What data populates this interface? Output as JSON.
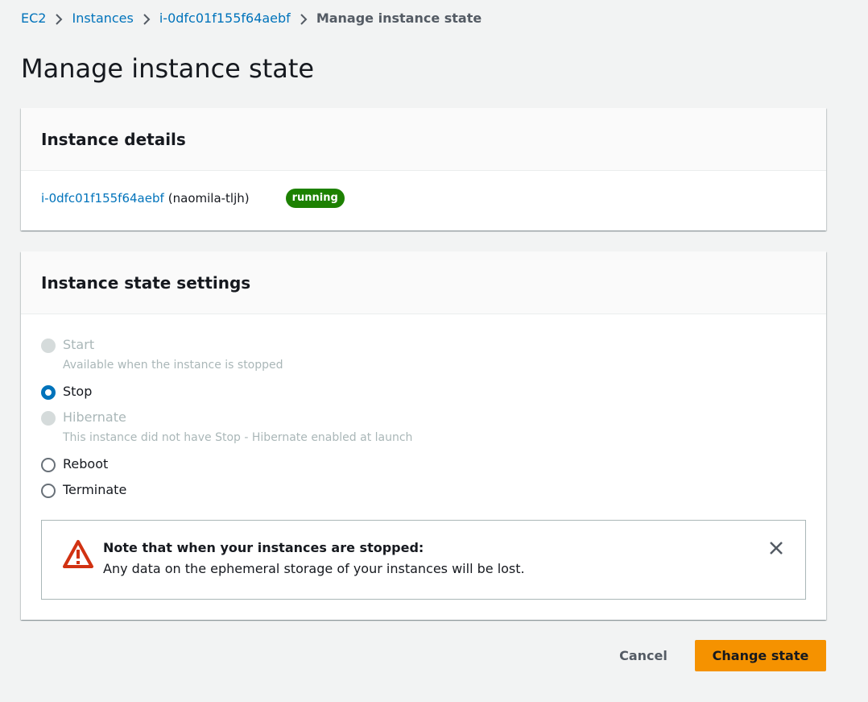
{
  "breadcrumb": {
    "items": [
      "EC2",
      "Instances",
      "i-0dfc01f155f64aebf"
    ],
    "current": "Manage instance state"
  },
  "page_title": "Manage instance state",
  "details": {
    "title": "Instance details",
    "instance_id": "i-0dfc01f155f64aebf",
    "instance_name": "(naomila-tljh)",
    "status": "running",
    "status_color": "#1d8102"
  },
  "settings": {
    "title": "Instance state settings",
    "options": [
      {
        "label": "Start",
        "description": "Available when the instance is stopped",
        "state": "disabled"
      },
      {
        "label": "Stop",
        "description": "",
        "state": "checked"
      },
      {
        "label": "Hibernate",
        "description": "This instance did not have Stop - Hibernate enabled at launch",
        "state": "disabled"
      },
      {
        "label": "Reboot",
        "description": "",
        "state": "enabled"
      },
      {
        "label": "Terminate",
        "description": "",
        "state": "enabled"
      }
    ],
    "selected": "Stop"
  },
  "alert": {
    "icon": "warning-icon",
    "title": "Note that when your instances are stopped:",
    "body": "Any data on the ephemeral storage of your instances will be lost.",
    "color": "#d13212"
  },
  "actions": {
    "cancel_label": "Cancel",
    "primary_label": "Change state",
    "primary_color": "#f59200",
    "link_color": "#0073bb"
  }
}
